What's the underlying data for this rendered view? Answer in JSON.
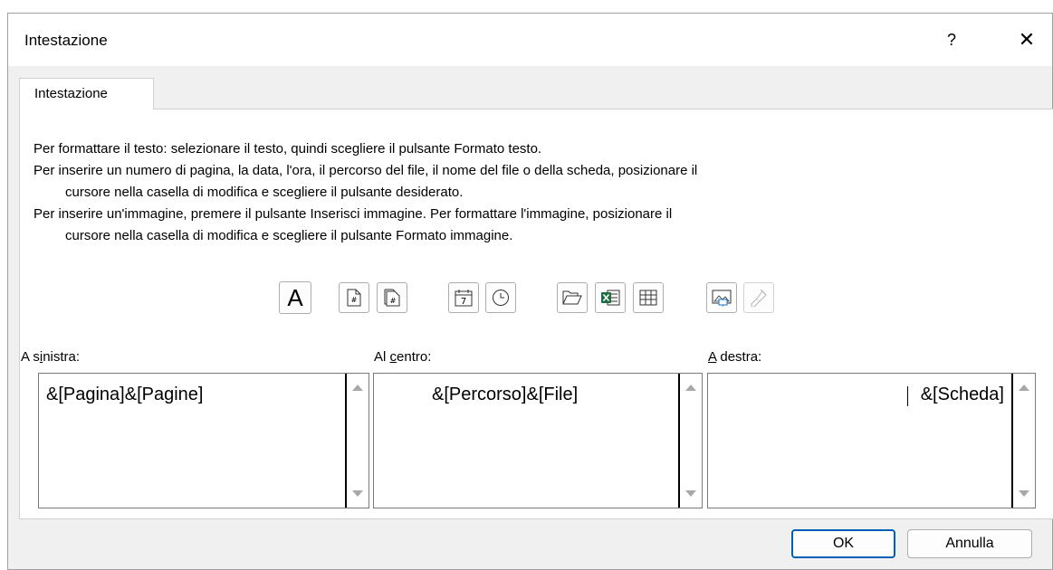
{
  "window": {
    "title": "Intestazione",
    "help_label": "?",
    "close_label": "✕"
  },
  "tab": {
    "label": "Intestazione"
  },
  "instructions": {
    "line1": "Per formattare il testo: selezionare il testo, quindi scegliere il pulsante Formato testo.",
    "line2": "Per inserire un numero di pagina, la data, l'ora, il percorso del file, il nome del file o della scheda, posizionare il",
    "line3": "cursore nella casella di modifica e scegliere il pulsante desiderato.",
    "line4": "Per inserire un'immagine, premere il pulsante Inserisci immagine. Per formattare l'immagine, posizionare il",
    "line5": "cursore nella casella di modifica e scegliere il pulsante Formato immagine."
  },
  "toolbar": {
    "format_text_glyph": "A",
    "date_glyph": "7"
  },
  "sections": {
    "left": {
      "label_pre": "A s",
      "label_u": "i",
      "label_post": "nistra:",
      "text": "&[Pagina]&[Pagine]"
    },
    "center": {
      "label_pre": "Al ",
      "label_u": "c",
      "label_post": "entro:",
      "text": "&[Percorso]&[File]"
    },
    "right": {
      "label_pre": "",
      "label_u": "A",
      "label_post": " destra:",
      "text": "&[Scheda]"
    }
  },
  "buttons": {
    "ok": "OK",
    "cancel": "Annulla"
  }
}
